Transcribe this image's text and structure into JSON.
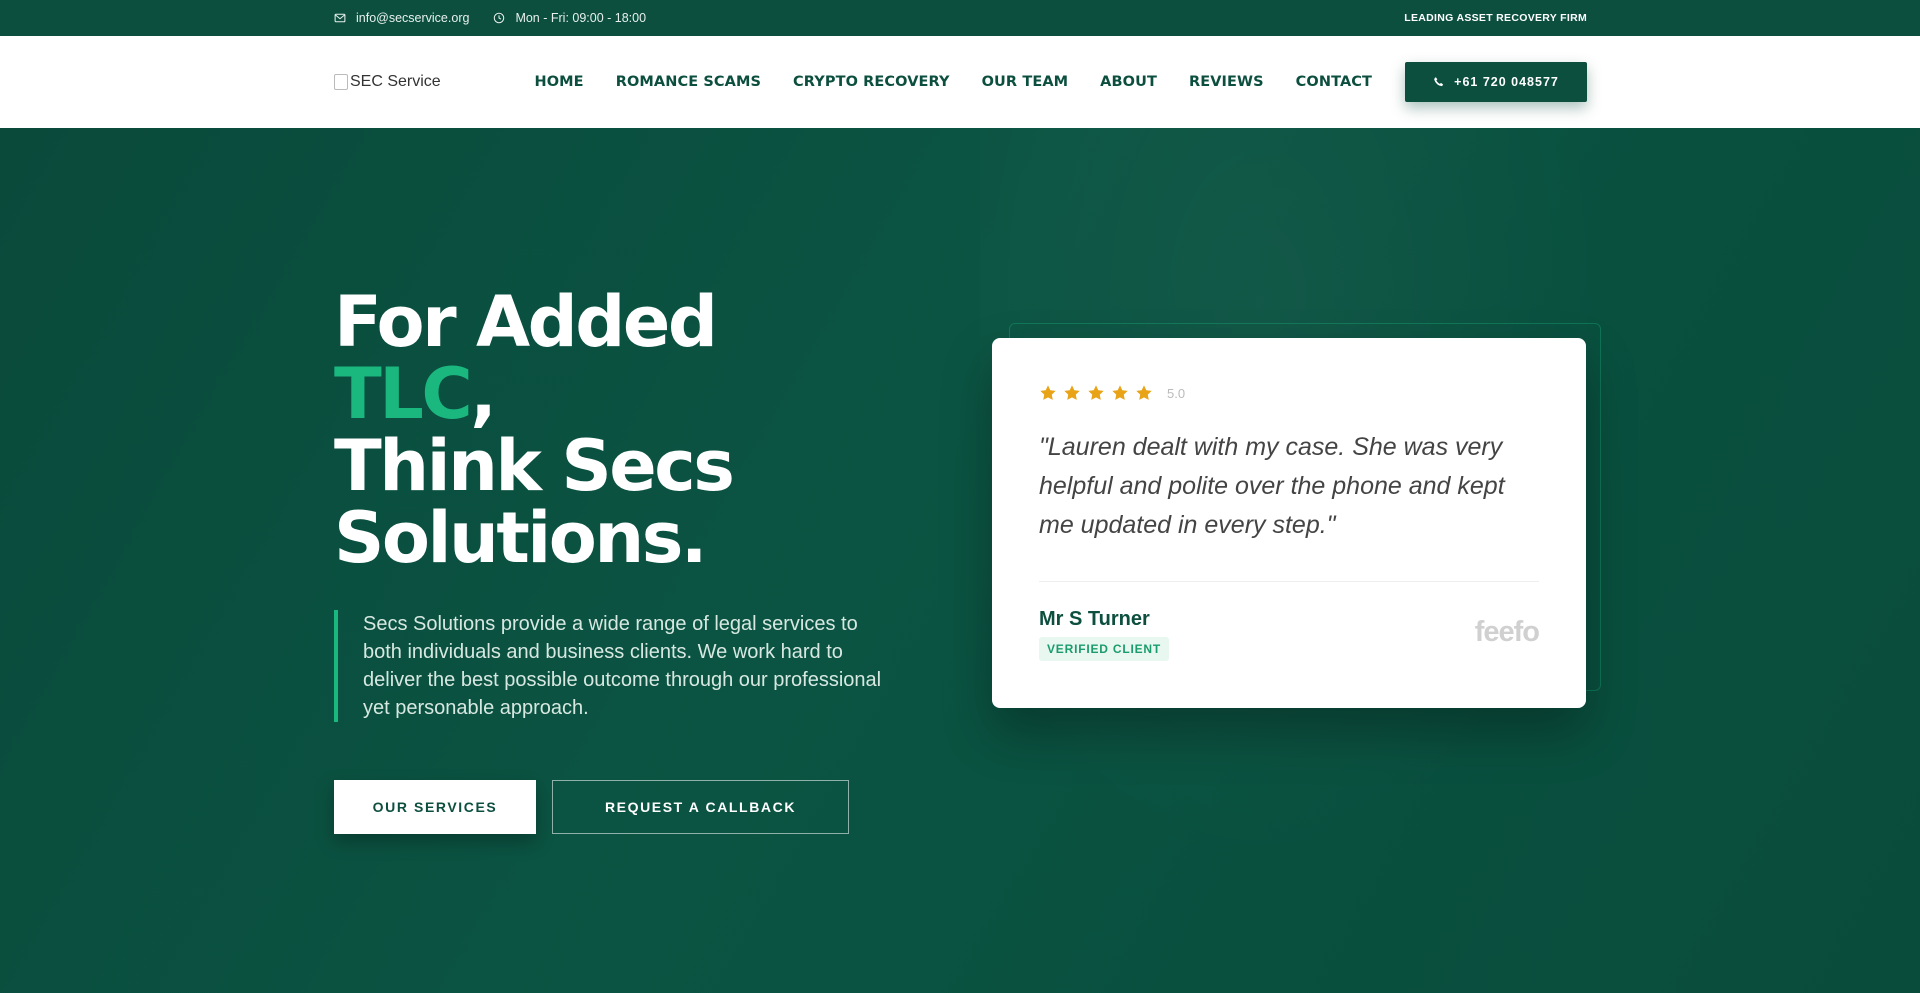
{
  "topbar": {
    "email": "info@secservice.org",
    "hours": "Mon - Fri: 09:00 - 18:00",
    "tagline": "LEADING ASSET RECOVERY FIRM"
  },
  "header": {
    "logo_alt": "SEC Service",
    "nav": [
      "HOME",
      "ROMANCE SCAMS",
      "CRYPTO RECOVERY",
      "OUR TEAM",
      "ABOUT",
      "REVIEWS",
      "CONTACT"
    ],
    "phone": "+61 720 048577"
  },
  "hero": {
    "headline_part1": "For Added ",
    "headline_accent": "TLC",
    "headline_part2": ",",
    "headline_line2": "Think Secs",
    "headline_line3": "Solutions.",
    "lead": "Secs Solutions provide a wide range of legal services to both individuals and business clients. We work hard to deliver the best possible outcome through our professional yet personable approach.",
    "cta_primary": "OUR SERVICES",
    "cta_secondary": "REQUEST A CALLBACK"
  },
  "review": {
    "rating": 5,
    "score_text": "5.0",
    "quote": "\"Lauren dealt with my case. She was very helpful and polite over the phone and kept me updated in every step.\"",
    "author": "Mr S Turner",
    "badge": "VERIFIED CLIENT",
    "provider": "feefo"
  },
  "colors": {
    "brand_dark": "#0d4f3f",
    "accent": "#1ab77f",
    "star": "#e8a317"
  },
  "icons": {
    "email": "envelope-icon",
    "hours": "clock-icon",
    "phone": "phone-icon",
    "star": "star-icon"
  }
}
